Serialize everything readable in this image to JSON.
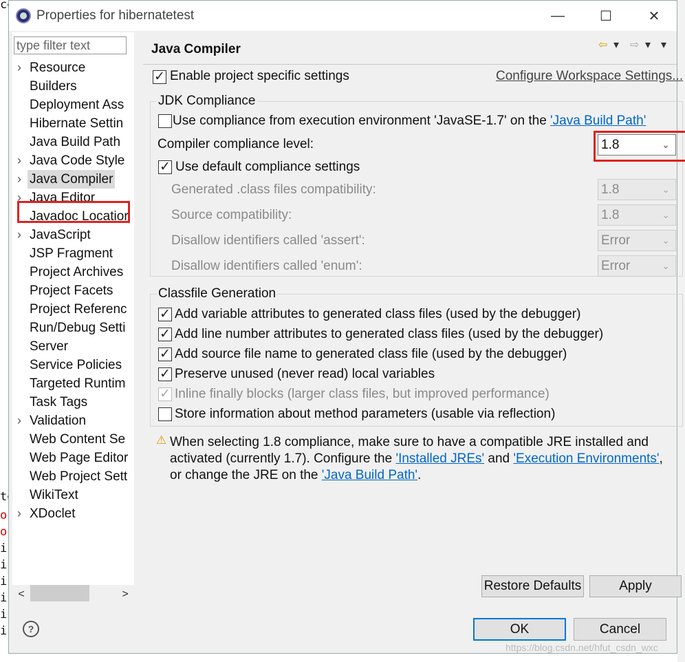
{
  "window": {
    "title": "Properties for hibernatetest",
    "minimize_glyph": "—",
    "maximize_glyph": "☐",
    "close_glyph": "✕"
  },
  "background_editor": {
    "lines": [
      {
        "text": "o",
        "color": "#cc0000"
      },
      {
        "text": "o",
        "color": "#cc0000"
      },
      {
        "text": "i",
        "color": "#111111"
      },
      {
        "text": "i",
        "color": "#111111"
      },
      {
        "text": "i",
        "color": "#111111"
      },
      {
        "text": "i",
        "color": "#111111"
      },
      {
        "text": "i",
        "color": "#111111"
      },
      {
        "text": "i",
        "color": "#111111"
      }
    ],
    "top_char": "ce",
    "mid_char": "te"
  },
  "filter": {
    "placeholder": "type filter text"
  },
  "tree": {
    "items": [
      {
        "label": "Resource",
        "expandable": true
      },
      {
        "label": "Builders",
        "expandable": false
      },
      {
        "label": "Deployment Ass",
        "expandable": false
      },
      {
        "label": "Hibernate Settin",
        "expandable": false
      },
      {
        "label": "Java Build Path",
        "expandable": false
      },
      {
        "label": "Java Code Style",
        "expandable": true
      },
      {
        "label": "Java Compiler",
        "expandable": true,
        "selected": true
      },
      {
        "label": "Java Editor",
        "expandable": true
      },
      {
        "label": "Javadoc Locatior",
        "expandable": false
      },
      {
        "label": "JavaScript",
        "expandable": true
      },
      {
        "label": "JSP Fragment",
        "expandable": false
      },
      {
        "label": "Project Archives",
        "expandable": false
      },
      {
        "label": "Project Facets",
        "expandable": false
      },
      {
        "label": "Project Referenc",
        "expandable": false
      },
      {
        "label": "Run/Debug Setti",
        "expandable": false
      },
      {
        "label": "Server",
        "expandable": false
      },
      {
        "label": "Service Policies",
        "expandable": false
      },
      {
        "label": "Targeted Runtim",
        "expandable": false
      },
      {
        "label": "Task Tags",
        "expandable": false
      },
      {
        "label": "Validation",
        "expandable": true
      },
      {
        "label": "Web Content Se",
        "expandable": false
      },
      {
        "label": "Web Page Editor",
        "expandable": false
      },
      {
        "label": "Web Project Sett",
        "expandable": false
      },
      {
        "label": "WikiText",
        "expandable": false
      },
      {
        "label": "XDoclet",
        "expandable": true
      }
    ],
    "scroll_left": "<",
    "scroll_right": ">"
  },
  "page": {
    "title": "Java Compiler",
    "nav_back": "⇦",
    "nav_forward": "⇨",
    "nav_menu": "▾",
    "enable_specific": {
      "label": "Enable project specific settings",
      "checked": true
    },
    "configure_link": "Configure Workspace Settings...",
    "jdk": {
      "title": "JDK Compliance",
      "use_env": {
        "label": "Use compliance from execution environment 'JavaSE-1.7' on the ",
        "link": "'Java Build Path'",
        "checked": false
      },
      "level_label": "Compiler compliance level:",
      "level_value": "1.8",
      "use_default": {
        "label": "Use default compliance settings",
        "checked": true
      },
      "rows": [
        {
          "label": "Generated .class files compatibility:",
          "value": "1.8"
        },
        {
          "label": "Source compatibility:",
          "value": "1.8"
        },
        {
          "label": "Disallow identifiers called 'assert':",
          "value": "Error"
        },
        {
          "label": "Disallow identifiers called 'enum':",
          "value": "Error"
        }
      ]
    },
    "classfile": {
      "title": "Classfile Generation",
      "options": [
        {
          "label": "Add variable attributes to generated class files (used by the debugger)",
          "checked": true,
          "disabled": false
        },
        {
          "label": "Add line number attributes to generated class files (used by the debugger)",
          "checked": true,
          "disabled": false
        },
        {
          "label": "Add source file name to generated class file (used by the debugger)",
          "checked": true,
          "disabled": false
        },
        {
          "label": "Preserve unused (never read) local variables",
          "checked": true,
          "disabled": false
        },
        {
          "label": "Inline finally blocks (larger class files, but improved performance)",
          "checked": true,
          "disabled": true
        },
        {
          "label": "Store information about method parameters (usable via reflection)",
          "checked": false,
          "disabled": false
        }
      ]
    },
    "warning": {
      "icon": "⚠",
      "line1": "When selecting 1.8 compliance, make sure to have a compatible JRE installed and",
      "line2_a": "activated (currently 1.7). Configure the ",
      "link_jres": "'Installed JREs'",
      "line2_b": " and ",
      "link_env": "'Execution Environments'",
      "line2_c": ",",
      "line3_a": "or change the JRE on the ",
      "link_bp": "'Java Build Path'",
      "line3_b": "."
    },
    "restore_label": "Restore Defaults",
    "apply_label": "Apply"
  },
  "footer": {
    "help": "?",
    "ok_label": "OK",
    "cancel_label": "Cancel",
    "watermark": "https://blog.csdn.net/hfut_csdn_wxc"
  }
}
